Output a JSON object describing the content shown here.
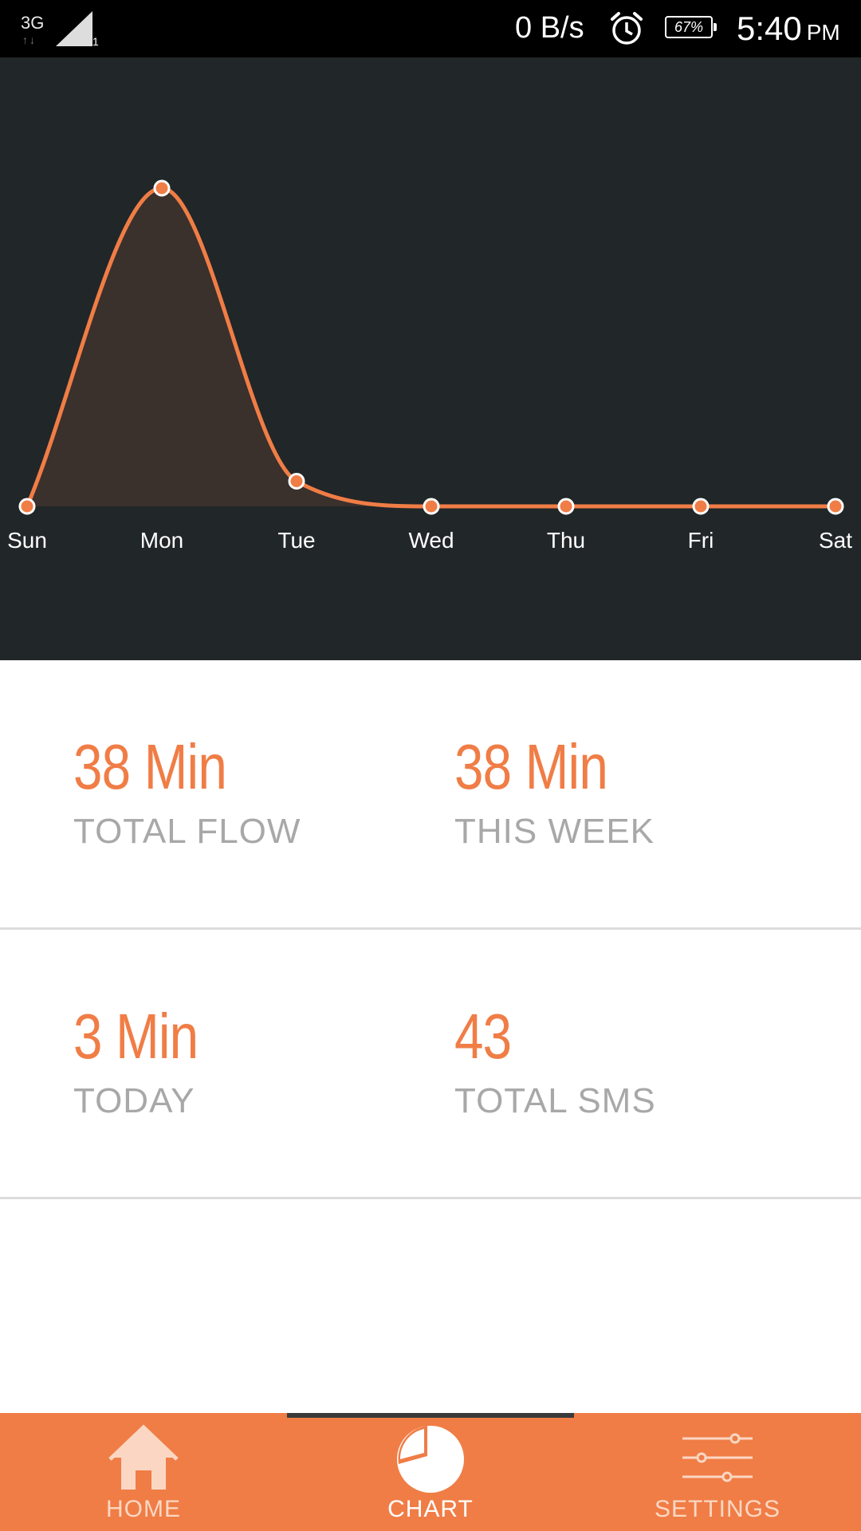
{
  "status_bar": {
    "network": "3G",
    "sim": "1",
    "speed": "0 B/s",
    "alarm_icon": "alarm-clock-icon",
    "battery": "67%",
    "time": "5:40",
    "ampm": "PM"
  },
  "chart_data": {
    "type": "area",
    "categories": [
      "Sun",
      "Mon",
      "Tue",
      "Wed",
      "Thu",
      "Fri",
      "Sat"
    ],
    "values": [
      0,
      38,
      3,
      0,
      0,
      0,
      0
    ],
    "ylim": [
      0,
      38
    ],
    "grid": false,
    "line_color": "#f07d46",
    "fill_color": "#3a302c"
  },
  "stats": [
    {
      "value": "38 Min",
      "label": "TOTAL FLOW"
    },
    {
      "value": "38 Min",
      "label": "THIS WEEK"
    },
    {
      "value": "3 Min",
      "label": "TODAY"
    },
    {
      "value": "43",
      "label": "TOTAL SMS"
    }
  ],
  "nav": {
    "items": [
      {
        "label": "HOME",
        "icon": "home-icon",
        "active": false
      },
      {
        "label": "CHART",
        "icon": "pie-chart-icon",
        "active": true
      },
      {
        "label": "SETTINGS",
        "icon": "sliders-icon",
        "active": false
      }
    ]
  },
  "colors": {
    "accent": "#f07d46",
    "chart_bg": "#212628",
    "label_gray": "#a8a8a8"
  }
}
